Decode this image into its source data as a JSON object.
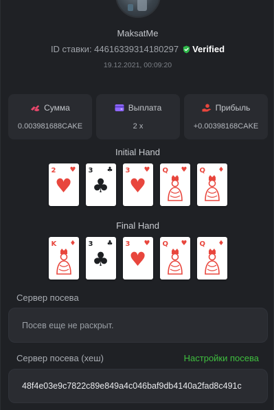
{
  "user": {
    "name": "MaksatMe"
  },
  "bet": {
    "id_label": "ID ставки: 4461633931418029​7",
    "verified_label": "Verified",
    "date": "19.12.2021, 00:09:20"
  },
  "stats": [
    {
      "label": "Сумма",
      "value": "0.003981688CAKE",
      "icon": "coins-icon",
      "color": "#e8476b"
    },
    {
      "label": "Выплата",
      "value": "2 x",
      "icon": "wallet-icon",
      "color": "#8f67ff"
    },
    {
      "label": "Прибыль",
      "value": "+0.00398168CAKE",
      "icon": "hand-coin-icon",
      "color": "#e8463d"
    }
  ],
  "initial_hand": {
    "title": "Initial Hand",
    "cards": [
      {
        "rank": "2",
        "suit": "♥",
        "color": "red"
      },
      {
        "rank": "3",
        "suit": "♣",
        "color": "black"
      },
      {
        "rank": "3",
        "suit": "♥",
        "color": "red"
      },
      {
        "rank": "Q",
        "suit": "♥",
        "color": "red"
      },
      {
        "rank": "Q",
        "suit": "♦",
        "color": "red"
      }
    ]
  },
  "final_hand": {
    "title": "Final Hand",
    "cards": [
      {
        "rank": "K",
        "suit": "♦",
        "color": "red"
      },
      {
        "rank": "3",
        "suit": "♣",
        "color": "black"
      },
      {
        "rank": "3",
        "suit": "♥",
        "color": "red"
      },
      {
        "rank": "Q",
        "suit": "♥",
        "color": "red"
      },
      {
        "rank": "Q",
        "suit": "♦",
        "color": "red"
      }
    ]
  },
  "server_seed": {
    "label": "Сервер посева",
    "value": "Посев еще не раскрыт."
  },
  "server_seed_hash": {
    "label": "Сервер посева (хеш)",
    "settings_link": "Настройки посева",
    "value": "48f4e03e9c7822c89e849a4c046baf9db4140a2fad8c491c"
  },
  "colors": {
    "verified_green": "#2fb84a",
    "link_green": "#3fbf3f",
    "card_red": "#e8463d"
  }
}
